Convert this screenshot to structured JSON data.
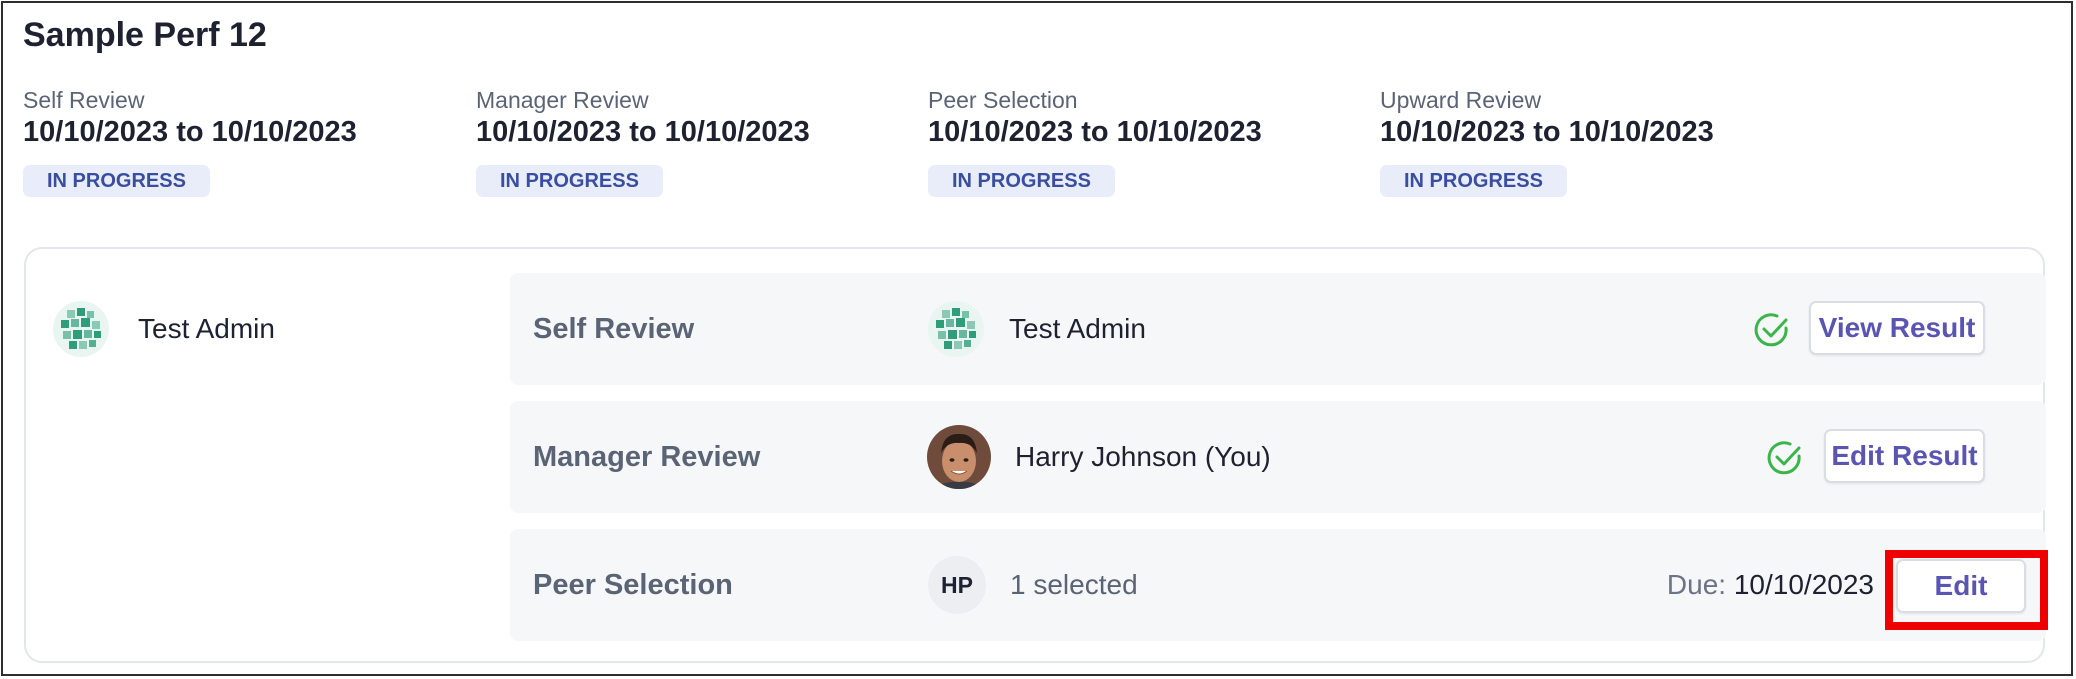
{
  "title": "Sample Perf 12",
  "stages": [
    {
      "label": "Self Review",
      "dates": "10/10/2023 to 10/10/2023",
      "status": "IN PROGRESS"
    },
    {
      "label": "Manager Review",
      "dates": "10/10/2023 to 10/10/2023",
      "status": "IN PROGRESS"
    },
    {
      "label": "Peer Selection",
      "dates": "10/10/2023 to 10/10/2023",
      "status": "IN PROGRESS"
    },
    {
      "label": "Upward Review",
      "dates": "10/10/2023 to 10/10/2023",
      "status": "IN PROGRESS"
    }
  ],
  "reviewee": {
    "name": "Test Admin",
    "avatar_icon": "org-globe-avatar"
  },
  "rows": [
    {
      "label": "Self Review",
      "person": "Test Admin",
      "avatar_icon": "org-globe-avatar",
      "completed": true,
      "action_label": "View Result"
    },
    {
      "label": "Manager Review",
      "person": "Harry Johnson (You)",
      "avatar_icon": "person-photo-avatar",
      "completed": true,
      "action_label": "Edit Result"
    },
    {
      "label": "Peer Selection",
      "initials": "HP",
      "selected_text": "1 selected",
      "due_label": "Due:",
      "due_date": "10/10/2023",
      "action_label": "Edit"
    }
  ],
  "colors": {
    "accent": "#5a55b0",
    "badge_bg": "#e8edf9",
    "badge_text": "#3a4ea0",
    "check": "#3bb54a",
    "highlight": "#ee0000"
  }
}
